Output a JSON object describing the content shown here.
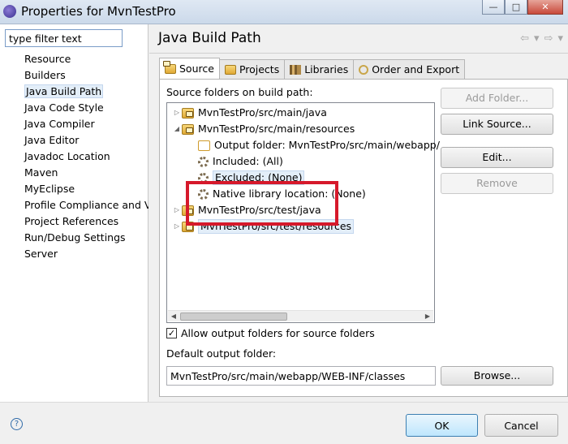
{
  "window": {
    "title": "Properties for MvnTestPro",
    "icon": "eclipse-icon",
    "buttons": {
      "minimize": "—",
      "maximize": "□",
      "close": "✕"
    }
  },
  "filter": {
    "placeholder": "type filter text",
    "value": "type filter text"
  },
  "nav": {
    "items": [
      "Resource",
      "Builders",
      "Java Build Path",
      "Java Code Style",
      "Java Compiler",
      "Java Editor",
      "Javadoc Location",
      "Maven",
      "MyEclipse",
      "Profile Compliance and Va",
      "Project References",
      "Run/Debug Settings",
      "Server"
    ],
    "selected": "Java Build Path"
  },
  "page": {
    "title": "Java Build Path",
    "nav_back": "⇦",
    "nav_menu": "▾",
    "nav_forward": "⇨",
    "nav_menu2": "▾"
  },
  "tabs": [
    "Source",
    "Projects",
    "Libraries",
    "Order and Export"
  ],
  "source": {
    "label": "Source folders on build path:",
    "tree": [
      {
        "text": "MvnTestPro/src/main/java",
        "expander": "▷"
      },
      {
        "text": "MvnTestPro/src/main/resources",
        "expander": "◢"
      },
      {
        "text": "Output folder: MvnTestPro/src/main/webapp/"
      },
      {
        "text": "Included: (All)"
      },
      {
        "text": "Excluded: (None)"
      },
      {
        "text": "Native library location: (None)"
      },
      {
        "text": "MvnTestPro/src/test/java",
        "expander": "▷"
      },
      {
        "text": "MvnTestPro/src/test/resources",
        "expander": "▷"
      }
    ],
    "buttons": {
      "add_folder": "Add Folder...",
      "link_source": "Link Source...",
      "edit": "Edit...",
      "remove": "Remove"
    },
    "allow_output_checkbox": {
      "label": "Allow output folders for source folders",
      "checked": true,
      "mark": "✓"
    },
    "default_output_label": "Default output folder:",
    "default_output_value": "MvnTestPro/src/main/webapp/WEB-INF/classes",
    "browse": "Browse..."
  },
  "footer": {
    "help": "?",
    "ok": "OK",
    "cancel": "Cancel"
  },
  "colors": {
    "highlight_box": "#d6192b",
    "selection": "#e3eef9"
  }
}
